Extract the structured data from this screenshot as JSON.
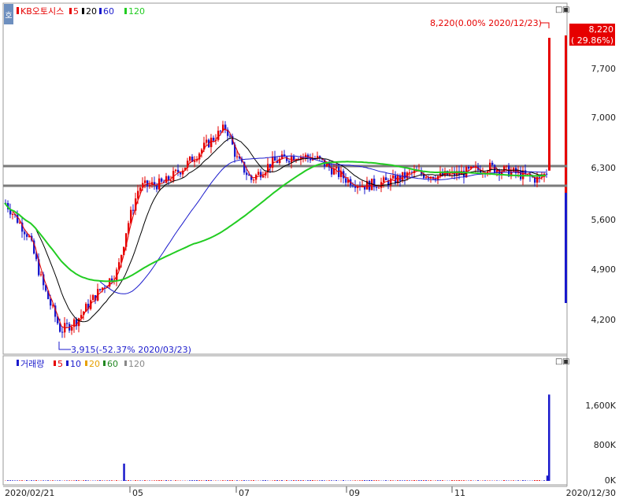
{
  "price_panel": {
    "legend_name": "KB오토시스",
    "legend_periods": [
      "5",
      "20",
      "60",
      "120"
    ],
    "y_ticks": [
      "8,220",
      "7,700",
      "7,000",
      "6,300",
      "5,600",
      "4,900",
      "4,200"
    ],
    "current_price_label": "8,220",
    "current_change_label": "( 29.86%)",
    "high_annotation": "8,220(0.00% 2020/12/23)",
    "low_annotation": "3,915(-52.37% 2020/03/23)",
    "ylim": [
      3800,
      8600
    ]
  },
  "volume_panel": {
    "legend_name": "거래량",
    "legend_periods": [
      "5",
      "10",
      "20",
      "60",
      "120"
    ],
    "y_ticks": [
      "1,600K",
      "800K",
      "0K"
    ],
    "ylim": [
      0,
      2000
    ]
  },
  "x_labels": [
    "2020/02/21",
    "05",
    "07",
    "09",
    "11",
    "2020/12/30"
  ],
  "icons": {
    "minimize": "□",
    "close": "▣",
    "side": "호"
  },
  "colors": {
    "up": "#e60000",
    "down": "#1a1acc",
    "ma5": "#e60000",
    "ma20": "#000000",
    "ma60": "#1a1acc",
    "ma120": "#22cc22",
    "support": "#7a7a7a"
  },
  "chart_data": {
    "type": "candlestick",
    "title": "KB오토시스",
    "x_range": [
      "2020/02/21",
      "2020/12/30"
    ],
    "price_high": 8220,
    "price_high_date": "2020/12/23",
    "price_low": 3915,
    "price_low_date": "2020/03/23",
    "last_change_pct": 29.86,
    "close_series": [
      {
        "x": "2020/02/21",
        "y": 5870
      },
      {
        "x": "2020/03/05",
        "y": 5400
      },
      {
        "x": "2020/03/13",
        "y": 4700
      },
      {
        "x": "2020/03/23",
        "y": 4050
      },
      {
        "x": "2020/04/01",
        "y": 4200
      },
      {
        "x": "2020/04/13",
        "y": 4600
      },
      {
        "x": "2020/04/24",
        "y": 4900
      },
      {
        "x": "2020/04/29",
        "y": 5500
      },
      {
        "x": "2020/05/06",
        "y": 6100
      },
      {
        "x": "2020/05/20",
        "y": 6150
      },
      {
        "x": "2020/06/01",
        "y": 6400
      },
      {
        "x": "2020/06/15",
        "y": 6750
      },
      {
        "x": "2020/06/24",
        "y": 6950
      },
      {
        "x": "2020/06/30",
        "y": 6500
      },
      {
        "x": "2020/07/08",
        "y": 6200
      },
      {
        "x": "2020/07/20",
        "y": 6450
      },
      {
        "x": "2020/08/03",
        "y": 6550
      },
      {
        "x": "2020/08/14",
        "y": 6500
      },
      {
        "x": "2020/08/31",
        "y": 6200
      },
      {
        "x": "2020/09/10",
        "y": 6120
      },
      {
        "x": "2020/09/25",
        "y": 6180
      },
      {
        "x": "2020/10/08",
        "y": 6300
      },
      {
        "x": "2020/10/22",
        "y": 6250
      },
      {
        "x": "2020/11/05",
        "y": 6300
      },
      {
        "x": "2020/11/19",
        "y": 6380
      },
      {
        "x": "2020/12/03",
        "y": 6300
      },
      {
        "x": "2020/12/17",
        "y": 6200
      },
      {
        "x": "2020/12/22",
        "y": 6330
      },
      {
        "x": "2020/12/23",
        "y": 8220
      }
    ],
    "moving_averages": [
      {
        "name": "5",
        "color": "#e60000"
      },
      {
        "name": "20",
        "color": "#000000"
      },
      {
        "name": "60",
        "color": "#1a1acc"
      },
      {
        "name": "120",
        "color": "#22cc22"
      }
    ],
    "horizontal_levels": [
      6330,
      6080
    ],
    "volume_series": [
      {
        "x": "2020/02/21",
        "y": 10
      },
      {
        "x": "2020/04/28",
        "y": 390
      },
      {
        "x": "2020/05/15",
        "y": 20
      },
      {
        "x": "2020/08/20",
        "y": 15
      },
      {
        "x": "2020/12/22",
        "y": 120
      },
      {
        "x": "2020/12/23",
        "y": 1950
      }
    ]
  }
}
